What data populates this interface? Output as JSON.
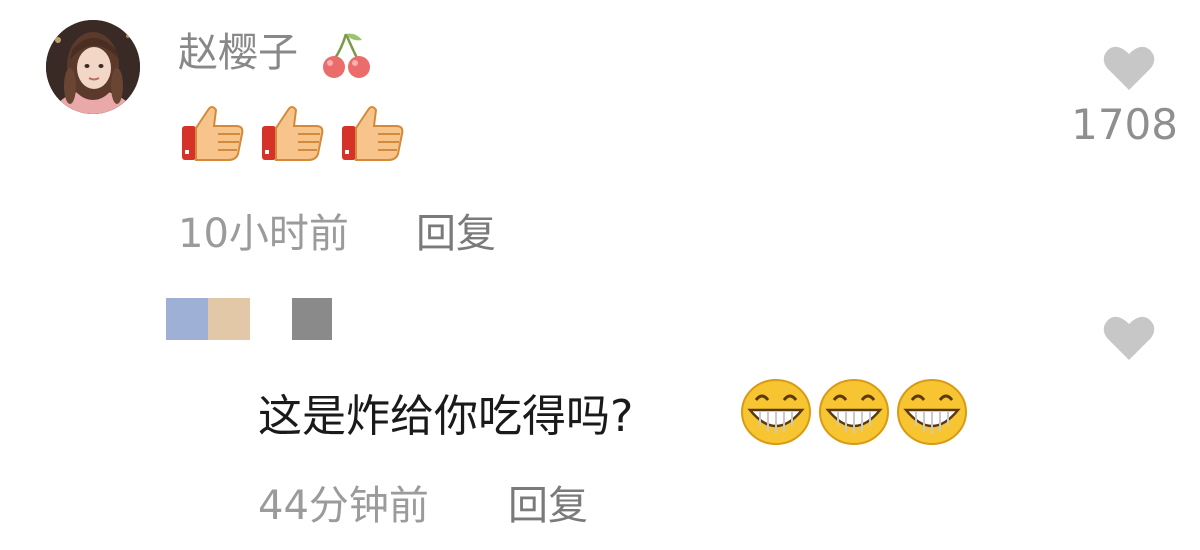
{
  "comments": [
    {
      "username": "赵樱子",
      "username_badge_icon": "cherry-icon",
      "emoji_icons": [
        "thumbs-up-icon",
        "thumbs-up-icon",
        "thumbs-up-icon"
      ],
      "time": "10小时前",
      "reply_label": "回复",
      "like_count": "1708",
      "like_icon": "heart-icon"
    },
    {
      "username_redacted": true,
      "redaction_colors": [
        "#9fb0d6",
        "#e3c8a8",
        "#8a8a8a"
      ],
      "text": "这是炸给你吃得吗?",
      "emoji_icons": [
        "grinning-face-icon",
        "grinning-face-icon",
        "grinning-face-icon"
      ],
      "time": "44分钟前",
      "reply_label": "回复",
      "like_icon": "heart-icon"
    }
  ],
  "colors": {
    "meta_text": "#9b9b9b",
    "heart": "#c7c7c7",
    "body_text": "#1a1a1a"
  }
}
